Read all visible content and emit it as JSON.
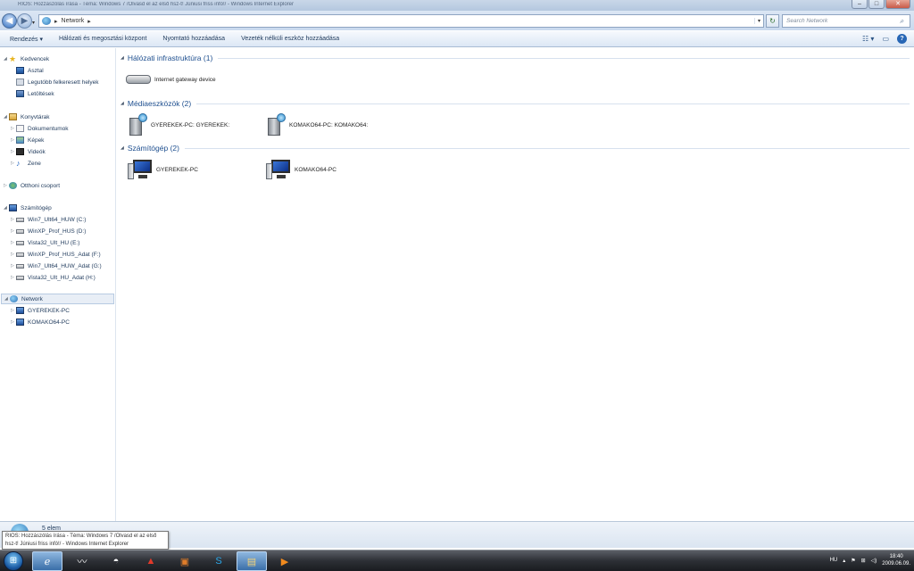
{
  "window": {
    "title": "RIOS: Hozzászólás írása - Téma: Windows 7 /Olvasd el az első hsz-t! Júniusi friss infó!/ - Windows Internet Explorer",
    "minimize": "–",
    "maximize": "□",
    "close": "✕"
  },
  "address": {
    "crumb": "Network",
    "search_placeholder": "Search Network"
  },
  "toolbar": {
    "organize": "Rendezés ▾",
    "network_center": "Hálózati és megosztási központ",
    "add_printer": "Nyomtató hozzáadása",
    "add_wireless": "Vezeték nélküli eszköz hozzáadása"
  },
  "sidebar": {
    "favorites": "Kedvencek",
    "desktop": "Asztal",
    "recent": "Legutóbb felkeresett helyek",
    "downloads": "Letöltések",
    "libraries": "Konyvtárak",
    "documents": "Dokumentumok",
    "pictures": "Képek",
    "videos": "Videók",
    "music": "Zene",
    "homegroup": "Otthoni csoport",
    "computer": "Számítógép",
    "drive_c": "Win7_Ult64_HUW (C:)",
    "drive_d": "WinXP_Prof_HUS (D:)",
    "drive_e": "Vista32_Ult_HU (E:)",
    "drive_f": "WinXP_Prof_HUS_Adat (F:)",
    "drive_g": "Win7_Ult64_HUW_Adat (G:)",
    "drive_h": "Vista32_Ult_HU_Adat (H:)",
    "network": "Network",
    "net_pc1": "GYEREKEK-PC",
    "net_pc2": "KOMAKO64-PC"
  },
  "groups": {
    "infra": "Hálózati infrastruktúra (1)",
    "infra_item": "Internet gateway device",
    "media": "Médiaeszközök (2)",
    "media_item1": "GYEREKEK-PC: GYEREKEK:",
    "media_item2": "KOMAKO64-PC: KOMAKO64:",
    "computers": "Számítógép (2)",
    "pc_item1": "GYEREKEK-PC",
    "pc_item2": "KOMAKO64-PC"
  },
  "status": {
    "count": "5 elem"
  },
  "tooltip": {
    "text": "RIOS: Hozzászólás írása - Téma: Windows 7 /Olvasd el az első hsz-t! Júniusi friss infó!/ - Windows Internet Explorer"
  },
  "taskbar": {
    "lang": "HU",
    "time": "18:40",
    "date": "2009.06.09."
  }
}
